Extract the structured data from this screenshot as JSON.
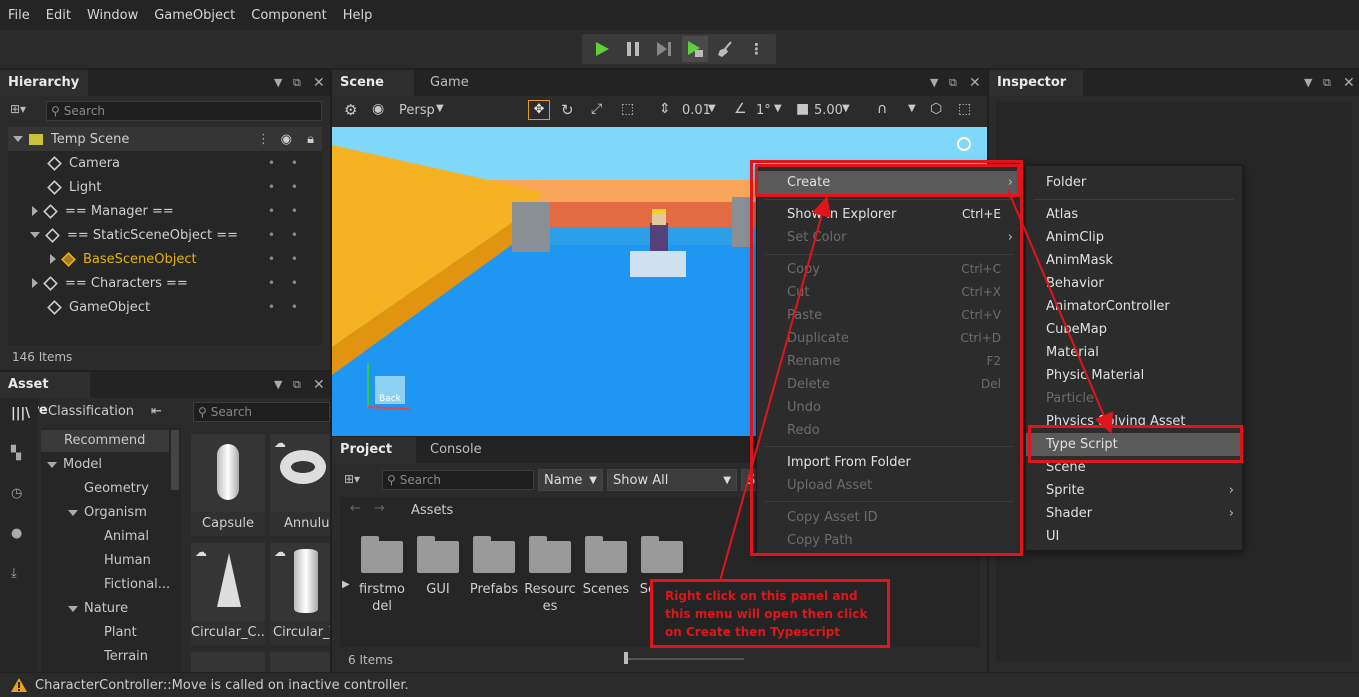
{
  "menubar": [
    "File",
    "Edit",
    "Window",
    "GameObject",
    "Component",
    "Help"
  ],
  "hierarchy": {
    "title": "Hierarchy",
    "search_placeholder": "Search",
    "scene_name": "Temp Scene",
    "items": [
      "Camera",
      "Light",
      "== Manager ==",
      "== StaticSceneObject ==",
      "BaseSceneObject",
      "== Characters ==",
      "GameObject"
    ],
    "count": "146 Items"
  },
  "asset_store": {
    "title": "Asset Store",
    "classification": "Classification",
    "search_placeholder": "Search",
    "tree": [
      "Recommend",
      "Model",
      "Geometry",
      "Organism",
      "Animal",
      "Human",
      "Fictional...",
      "Nature",
      "Plant",
      "Terrain"
    ],
    "cards": [
      "Capsule",
      "Annulus",
      "Circular_C...",
      "Circular_T"
    ]
  },
  "scene": {
    "tab_scene": "Scene",
    "tab_game": "Game",
    "view_mode": "Persp",
    "snap_move": "0.01",
    "snap_angle": "1°",
    "camera_speed": "5.00",
    "gizmo_label": "Back"
  },
  "project": {
    "tab_project": "Project",
    "tab_console": "Console",
    "search_placeholder": "Search",
    "sort": "Name",
    "filter": "Show All",
    "extra": "Se",
    "breadcrumb": "Assets",
    "folders": [
      "firstmodel",
      "GUI",
      "Prefabs",
      "Resources",
      "Scenes",
      "Scripts"
    ],
    "folder_labels": [
      "firstmo\ndel",
      "GUI",
      "Prefabs",
      "Resourc\nes",
      "Scenes",
      "Scripts"
    ],
    "count": "6 Items"
  },
  "inspector": {
    "title": "Inspector"
  },
  "context_menu": {
    "create": "Create",
    "show_in_explorer": "Show in Explorer",
    "show_in_explorer_sc": "Ctrl+E",
    "set_color": "Set Color",
    "copy": "Copy",
    "copy_sc": "Ctrl+C",
    "cut": "Cut",
    "cut_sc": "Ctrl+X",
    "paste": "Paste",
    "paste_sc": "Ctrl+V",
    "duplicate": "Duplicate",
    "duplicate_sc": "Ctrl+D",
    "rename": "Rename",
    "rename_sc": "F2",
    "delete": "Delete",
    "delete_sc": "Del",
    "undo": "Undo",
    "redo": "Redo",
    "import_folder": "Import From Folder",
    "upload_asset": "Upload Asset",
    "copy_asset_id": "Copy Asset ID",
    "copy_path": "Copy Path"
  },
  "submenu": [
    "Folder",
    "Atlas",
    "AnimClip",
    "AnimMask",
    "Behavior",
    "AnimatorController",
    "CubeMap",
    "Material",
    "Physic Material",
    "Particle",
    "Physics Solving Asset",
    "Type Script",
    "Scene",
    "Sprite",
    "Shader",
    "UI"
  ],
  "annotation": "Right click on this panel and this menu will open then click on Create then Typescript",
  "status": "CharacterController::Move is called on inactive controller.",
  "colors": {
    "annotation_red": "#e0141b",
    "play_green": "#5fcf3c",
    "selection": "#5a5a5a"
  }
}
